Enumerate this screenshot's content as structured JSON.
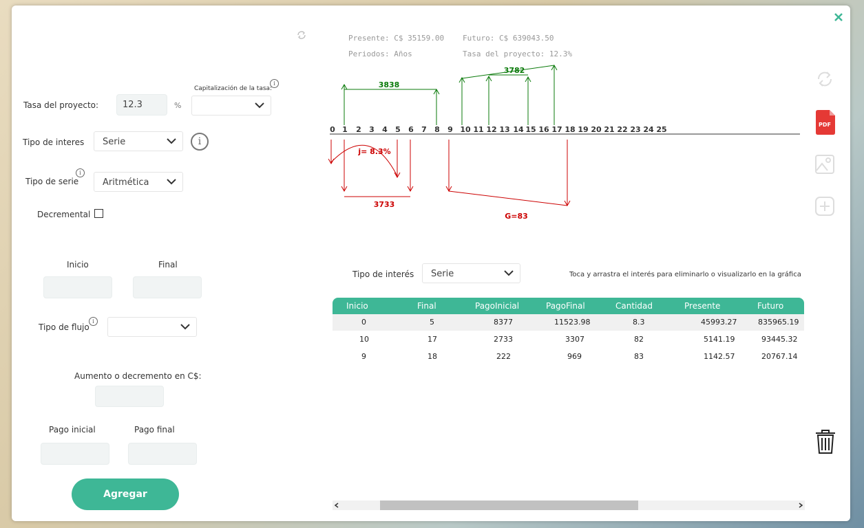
{
  "left": {
    "tasa_label": "Tasa del proyecto:",
    "tasa_value": "12.3",
    "tasa_unit": "%",
    "capitalizacion_label": "Capitalización de la tasa:",
    "tipo_interes_label": "Tipo de interes",
    "tipo_interes_value": "Serie",
    "tipo_serie_label": "Tipo de serie",
    "tipo_serie_value": "Aritmética",
    "decremental_label": "Decremental",
    "inicio_label": "Inicio",
    "final_label": "Final",
    "tipo_flujo_label": "Tipo de flujo",
    "aumento_label": "Aumento o decremento en C$:",
    "pago_inicial_label": "Pago inicial",
    "pago_final_label": "Pago final",
    "agregar_label": "Agregar"
  },
  "info": {
    "presente": "Presente: C$ 35159.00",
    "futuro": "Futuro: C$ 639043.50",
    "periodos": "Periodos: Años",
    "tasa": "Tasa del proyecto: 12.3%"
  },
  "diagram": {
    "ticks": [
      "0",
      "1",
      "2",
      "3",
      "4",
      "5",
      "6",
      "7",
      "8",
      "9",
      "10",
      "11",
      "12",
      "13",
      "14",
      "15",
      "16",
      "17",
      "18",
      "19",
      "20",
      "21",
      "22",
      "23",
      "24",
      "25"
    ],
    "label_3838": "3838",
    "label_3782": "3782",
    "label_j": "j= 8.3%",
    "label_3733": "3733",
    "label_G": "G=83",
    "green": "#0a7a0a",
    "red": "#cc0000"
  },
  "right": {
    "tipo_interes_label": "Tipo de interés",
    "tipo_interes_value": "Serie",
    "hint": "Toca y arrastra el interés para eliminarlo o visualizarlo en la gráfica",
    "pdf_label": "PDF"
  },
  "table": {
    "headers": [
      "Inicio",
      "Final",
      "PagoInicial",
      "PagoFinal",
      "Cantidad",
      "Presente",
      "Futuro"
    ],
    "rows": [
      [
        "0",
        "5",
        "8377",
        "11523.98",
        "8.3",
        "45993.27",
        "835965.19"
      ],
      [
        "10",
        "17",
        "2733",
        "3307",
        "82",
        "5141.19",
        "93445.32"
      ],
      [
        "9",
        "18",
        "222",
        "969",
        "83",
        "1142.57",
        "20767.14"
      ]
    ]
  },
  "colors": {
    "accent": "#3eb796",
    "pdf": "#e53935"
  }
}
